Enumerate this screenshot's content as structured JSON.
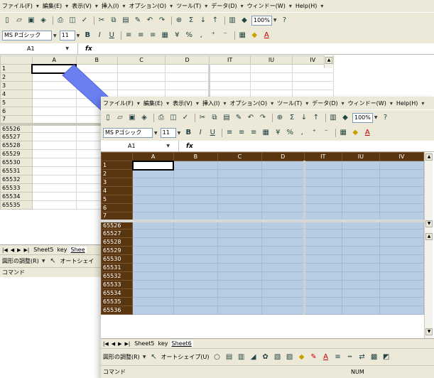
{
  "back_window": {
    "menu": [
      "ファイル(F)",
      "編集(E)",
      "表示(V)",
      "挿入(I)",
      "オプション(O)",
      "ツール(T)",
      "データ(D)",
      "ウィンドー(W)",
      "Help(H)"
    ],
    "zoom": "100%",
    "font_name": "MS Pゴシック",
    "font_size": "11",
    "name_box": "A1",
    "fx_label": "fx",
    "columns": [
      "A",
      "B",
      "C",
      "D",
      "IT",
      "IU",
      "IV"
    ],
    "rows_top": [
      "1",
      "2",
      "3",
      "4",
      "5",
      "6",
      "7"
    ],
    "rows_bottom": [
      "65526",
      "65527",
      "65528",
      "65529",
      "65530",
      "65531",
      "65532",
      "65533",
      "65534",
      "65535"
    ],
    "sheet_tabs": [
      "Sheet5",
      "key",
      "Shee"
    ],
    "draw_toolbar": {
      "draw_menu": "図形の調整(R)",
      "autoshape": "オートシェイ"
    },
    "status": "コマンド"
  },
  "front_window": {
    "menu": [
      "ファイル(F)",
      "編集(E)",
      "表示(V)",
      "挿入(I)",
      "オプション(O)",
      "ツール(T)",
      "データ(D)",
      "ウィンドー(W)",
      "Help(H)"
    ],
    "zoom": "100%",
    "font_name": "MS Pゴシック",
    "font_size": "11",
    "name_box": "A1",
    "fx_label": "fx",
    "columns": [
      "A",
      "B",
      "C",
      "D",
      "IT",
      "IU",
      "IV"
    ],
    "rows_top": [
      "1",
      "2",
      "3",
      "4",
      "5",
      "6",
      "7"
    ],
    "rows_bottom": [
      "65526",
      "65527",
      "65528",
      "65529",
      "65530",
      "65531",
      "65532",
      "65533",
      "65534",
      "65535",
      "65536"
    ],
    "sheet_tabs": [
      "Sheet5",
      "key",
      "Sheet6"
    ],
    "draw_toolbar": {
      "draw_menu": "図形の調整(R)",
      "autoshape": "オートシェイプ(U)"
    },
    "status": "コマンド",
    "status_num": "NUM"
  },
  "colors": {
    "selection_fill": "#b8cce4",
    "header_brown": "#5a3610",
    "arrow_blue": "#6a7ff0",
    "toolbar_bg": "#ece9d8"
  }
}
